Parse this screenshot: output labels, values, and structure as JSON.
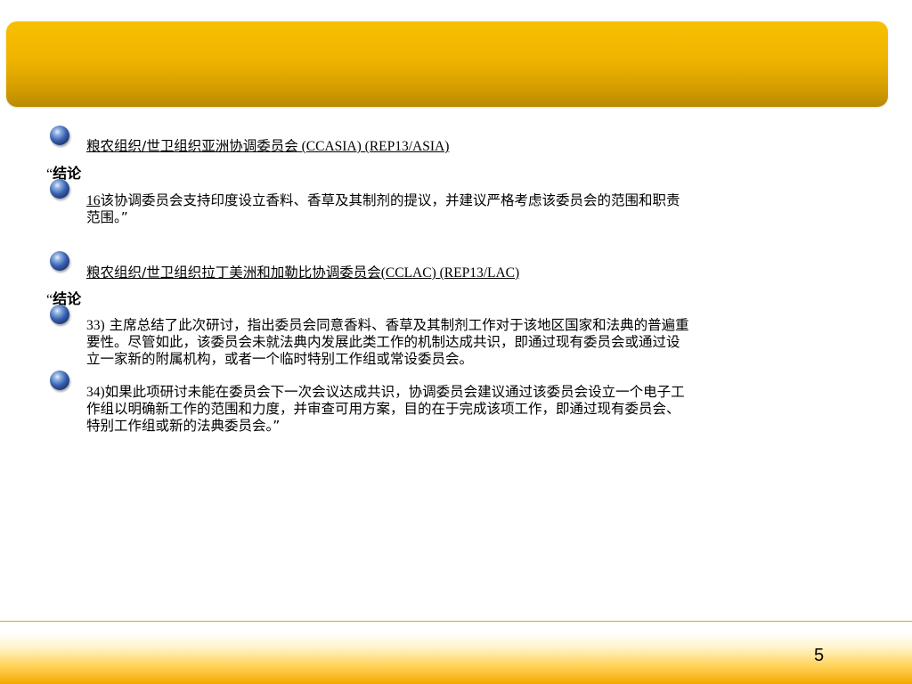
{
  "slide": {
    "section1": {
      "heading_cn": "粮农组织/世卫组织亚洲协调委员会",
      "heading_code": " (CCASIA) (REP13/ASIA)",
      "conclusion_quote": "“",
      "conclusion_label": "结论",
      "item_num": "16",
      "item_text_line1": "该协调委员会支持印度设立香料、香草及其制剂的提议，并建议严格考虑该委员会的范围和职责",
      "item_text_line2": "范围。”"
    },
    "section2": {
      "heading_cn": "粮农组织/世卫组织拉丁美洲和加勒比协调委员会",
      "heading_code": "(CCLAC) (REP13/LAC)",
      "conclusion_quote": "“",
      "conclusion_label": "结论",
      "item33_num": "33)",
      "item33_line1": " 主席总结了此次研讨，指出委员会同意香料、香草及其制剂工作对于该地区国家和法典的普遍重",
      "item33_line2": "要性。尽管如此，该委员会未就法典内发展此类工作的机制达成共识，即通过现有委员会或通过设",
      "item33_line3": "立一家新的附属机构，或者一个临时特别工作组或常设委员会。",
      "item34_num": "34)",
      "item34_line1": "如果此项研讨未能在委员会下一次会议达成共识，协调委员会建议通过该委员会设立一个电子工",
      "item34_line2": "作组以明确新工作的范围和力度，并审查可用方案，目的在于完成该项工作，即通过现有委员会、",
      "item34_line3": "特别工作组或新的法典委员会。”"
    },
    "page_number": "5"
  }
}
